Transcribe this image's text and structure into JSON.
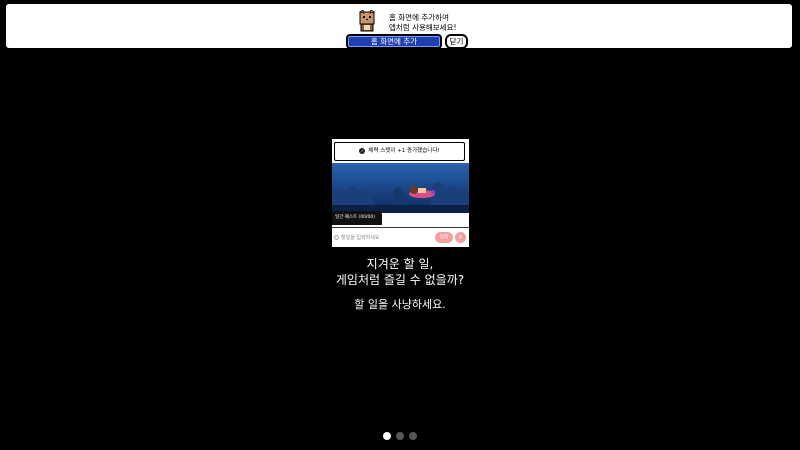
{
  "banner": {
    "message_line1": "홈 화면에 추가하여",
    "message_line2": "앱처럼 사용해보세요!",
    "add_button": "홈 화면에 추가",
    "close_button": "닫기"
  },
  "preview": {
    "toast": "체력 스탯이 +1 증가했습니다!",
    "quest_label": "일간 퀘스트 (00/00)",
    "task_placeholder": "할일을 입력하세요",
    "confirm_button": "입력",
    "cancel_button": "×"
  },
  "slide": {
    "headline_line1": "지겨운 할 일,",
    "headline_line2": "게임처럼 즐길 수 없을까?",
    "subline": "할 일을 사냥하세요."
  },
  "pagination": {
    "total": 3,
    "active_index": 0
  },
  "colors": {
    "accent": "#1f3fb0",
    "background": "#000000",
    "confirm_pink": "#f2a0a0"
  }
}
